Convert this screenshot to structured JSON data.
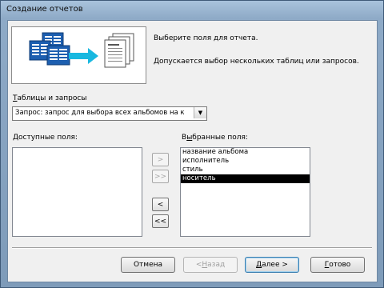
{
  "window": {
    "title": "Создание отчетов"
  },
  "intro": {
    "line1": "Выберите поля для отчета.",
    "line2": "Допускается выбор нескольких таблиц или запросов."
  },
  "source": {
    "label_underlined": "Т",
    "label_rest": "аблицы и запросы",
    "value": "Запрос: запрос для выбора всех альбомов на к",
    "dropdown_icon": "chevron-down-icon"
  },
  "available": {
    "label": "Доступные поля:",
    "items": []
  },
  "selected": {
    "label_pre": "В",
    "label_underlined": "ы",
    "label_rest": "бранные поля:",
    "items": [
      {
        "text": "название альбома",
        "selected": false
      },
      {
        "text": "исполнитель",
        "selected": false
      },
      {
        "text": "стиль",
        "selected": false
      },
      {
        "text": "носитель",
        "selected": true
      }
    ]
  },
  "move_buttons": {
    "add_one": ">",
    "add_all": ">>",
    "remove_one": "<",
    "remove_all": "<<"
  },
  "footer": {
    "cancel": "Отмена",
    "back_prefix": "< ",
    "back_underlined": "Н",
    "back_rest": "азад",
    "next_underlined": "Д",
    "next_rest": "алее >",
    "finish_underlined": "Г",
    "finish_rest": "отово"
  },
  "colors": {
    "selection": "#000000",
    "title_bar": "#a9c3dd",
    "dialog_bg": "#f0f0f0"
  }
}
